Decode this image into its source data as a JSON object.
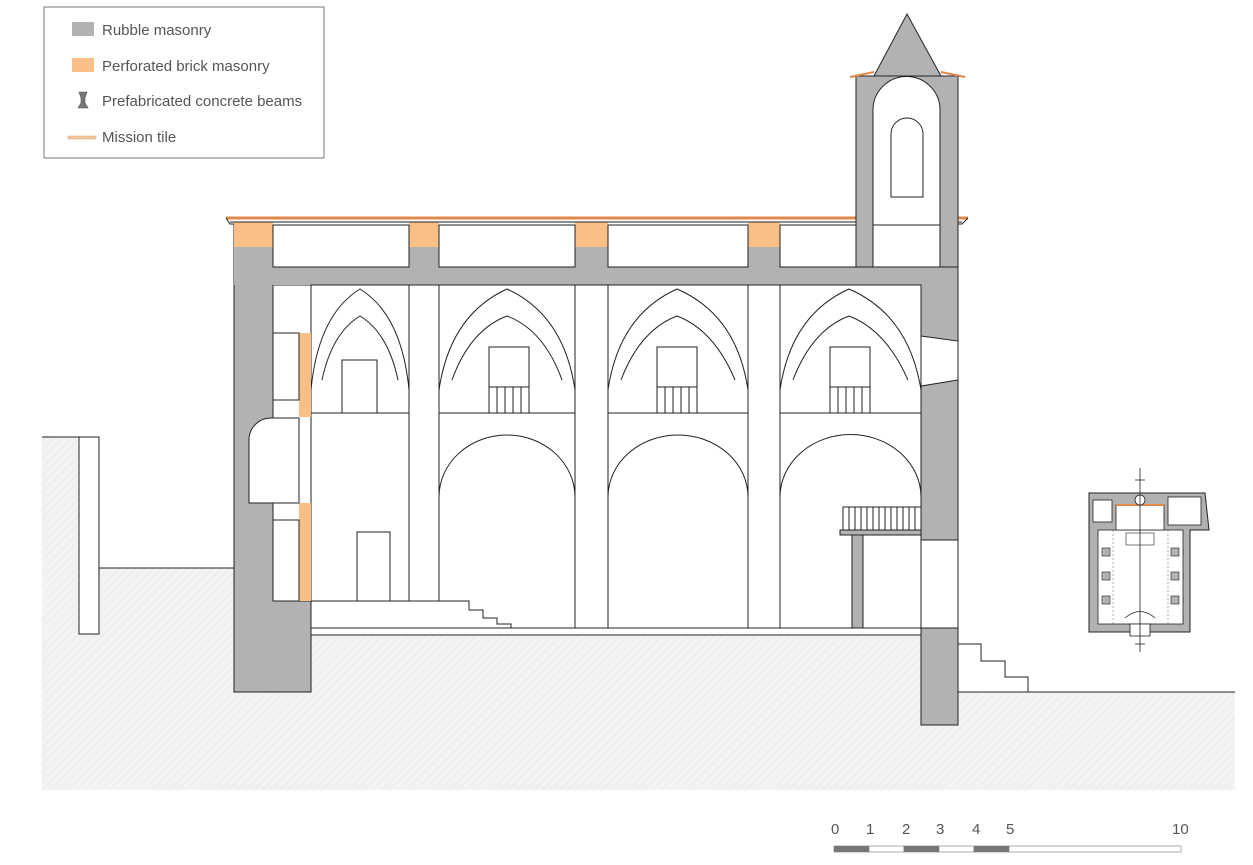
{
  "legend": {
    "items": [
      {
        "label": "Rubble masonry",
        "swatch": "rubble-masonry-swatch",
        "color": "#b2b2b2"
      },
      {
        "label": "Perforated brick masonry",
        "swatch": "brick-masonry-swatch",
        "color": "#f8bf86"
      },
      {
        "label": "Prefabricated concrete beams",
        "swatch": "concrete-beam-icon",
        "color": "#777777"
      },
      {
        "label": "Mission tile",
        "swatch": "mission-tile-swatch",
        "color": "#e8a060"
      }
    ]
  },
  "scale_bar": {
    "labels": [
      "0",
      "1",
      "2",
      "3",
      "4",
      "5",
      "10"
    ]
  },
  "colors": {
    "rubble": "#b2b2b2",
    "brick": "#f8bf86",
    "tile": "#e0884a",
    "ground": "#f2f2f2",
    "line": "#222222"
  }
}
